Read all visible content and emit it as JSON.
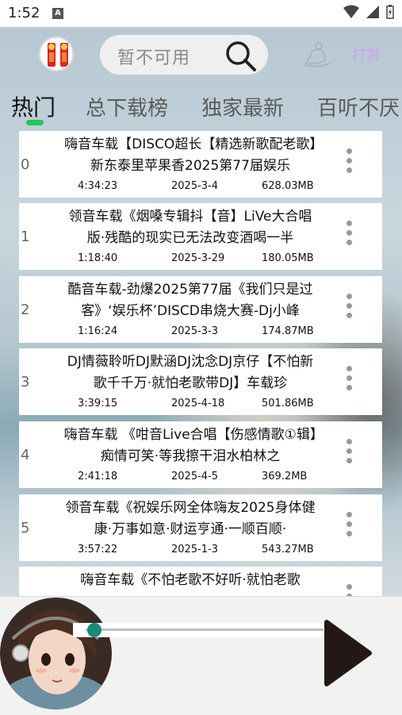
{
  "status": {
    "time": "1:52",
    "notif_letter": "A"
  },
  "search": {
    "placeholder": "暂不可用"
  },
  "header": {
    "side_text": "打赏"
  },
  "tabs": [
    {
      "label": "热门",
      "active": true
    },
    {
      "label": "总下载榜",
      "active": false
    },
    {
      "label": "独家最新",
      "active": false
    },
    {
      "label": "百听不厌",
      "active": false
    }
  ],
  "songs": [
    {
      "index": "0",
      "title": "嗨音车载【DISCO超长【精选新歌配老歌】新东泰里苹果香2025第77届娱乐",
      "duration": "4:34:23",
      "date": "2025-3-4",
      "size": "628.03MB"
    },
    {
      "index": "1",
      "title": "领音车载《烟嗓专辑抖【音】LiVe大合唱版·残酷的现实已无法改变酒喝一半",
      "duration": "1:18:40",
      "date": "2025-3-29",
      "size": "180.05MB"
    },
    {
      "index": "2",
      "title": "酷音车载-劲爆2025第77届《我们只是过客》‘娱乐杯’DISCD串烧大赛-Dj小峰",
      "duration": "1:16:24",
      "date": "2025-3-3",
      "size": "174.87MB"
    },
    {
      "index": "3",
      "title": "DJ情薇聆听DJ默涵DJ沈念DJ京仔【不怕新歌千千万·就怕老歌带DJ】车载珍",
      "duration": "3:39:15",
      "date": "2025-4-18",
      "size": "501.86MB"
    },
    {
      "index": "4",
      "title": "嗨音车载 《咁音Live合唱【伤感情歌①辑】痴情可笑·等我擦干泪水柏林之",
      "duration": "2:41:18",
      "date": "2025-4-5",
      "size": "369.2MB"
    },
    {
      "index": "5",
      "title": "领音车载《祝娱乐网全体嗨友2025身体健康·万事如意·财运亨通·一顺百顺·",
      "duration": "3:57:22",
      "date": "2025-1-3",
      "size": "543.27MB"
    },
    {
      "index": "",
      "title": "嗨音车载《不怕老歌不好听·就怕老歌",
      "duration": "",
      "date": "",
      "size": ""
    }
  ],
  "player": {
    "progress": 0.02
  },
  "colors": {
    "accent": "#22c55e",
    "knob": "#1d8a78",
    "extra_text": "#c8a2f0"
  }
}
